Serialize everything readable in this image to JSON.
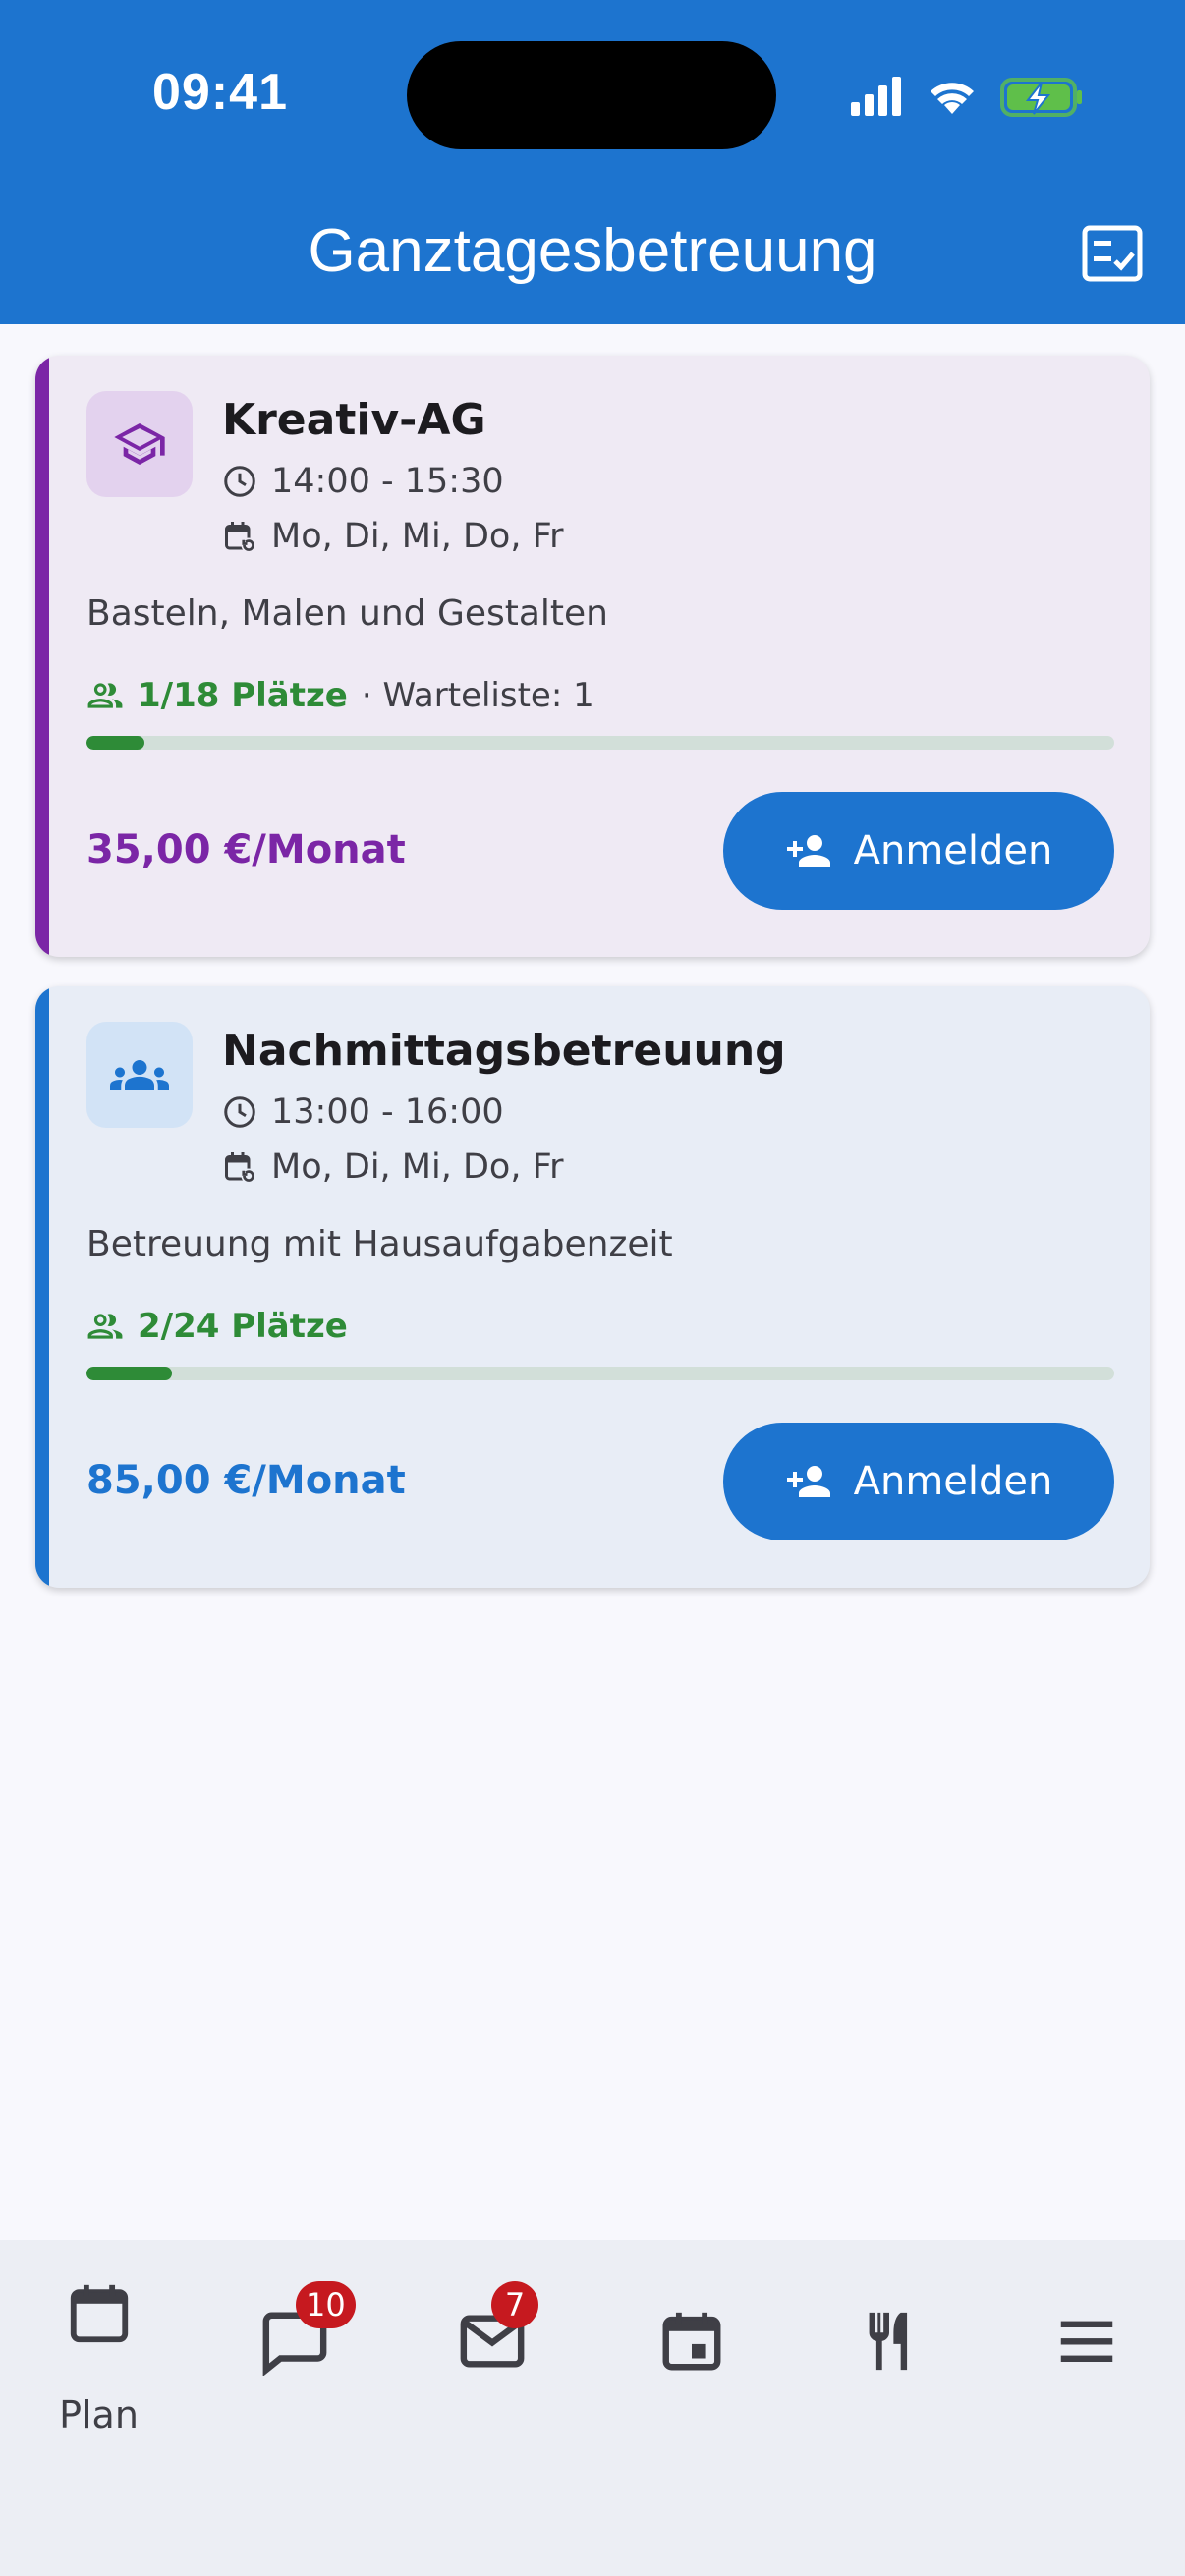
{
  "status_bar": {
    "time": "09:41"
  },
  "header": {
    "title": "Ganztagesbetreuung"
  },
  "cards": [
    {
      "name": "Kreativ-AG",
      "time": "14:00 - 15:30",
      "days": "Mo, Di, Mi, Do, Fr",
      "description": "Basteln, Malen und Gestalten",
      "places": "1/18 Plätze",
      "waitlist": "· Warteliste: 1",
      "capacity_fraction": 0.056,
      "price": "35,00 €/Monat",
      "button_label": "Anmelden",
      "accent_color": "#7b26a6",
      "icon_bg": "#e3d2ee",
      "card_bg": "#efeaf4",
      "icon": "graduation-cap-icon"
    },
    {
      "name": "Nachmittagsbetreuung",
      "time": "13:00 - 16:00",
      "days": "Mo, Di, Mi, Do, Fr",
      "description": "Betreuung mit Hausaufgabenzeit",
      "places": "2/24 Plätze",
      "capacity_fraction": 0.083,
      "price": "85,00 €/Monat",
      "button_label": "Anmelden",
      "accent_color": "#1d74cf",
      "icon_bg": "#d2e3f6",
      "card_bg": "#e8edf6",
      "icon": "group-icon"
    }
  ],
  "bottom_nav": {
    "plan_label": "Plan",
    "chat_badge": "10",
    "mail_badge": "7"
  },
  "colors": {
    "primary": "#1d74cf",
    "success": "#2e8b37",
    "badge": "#c6191f"
  }
}
